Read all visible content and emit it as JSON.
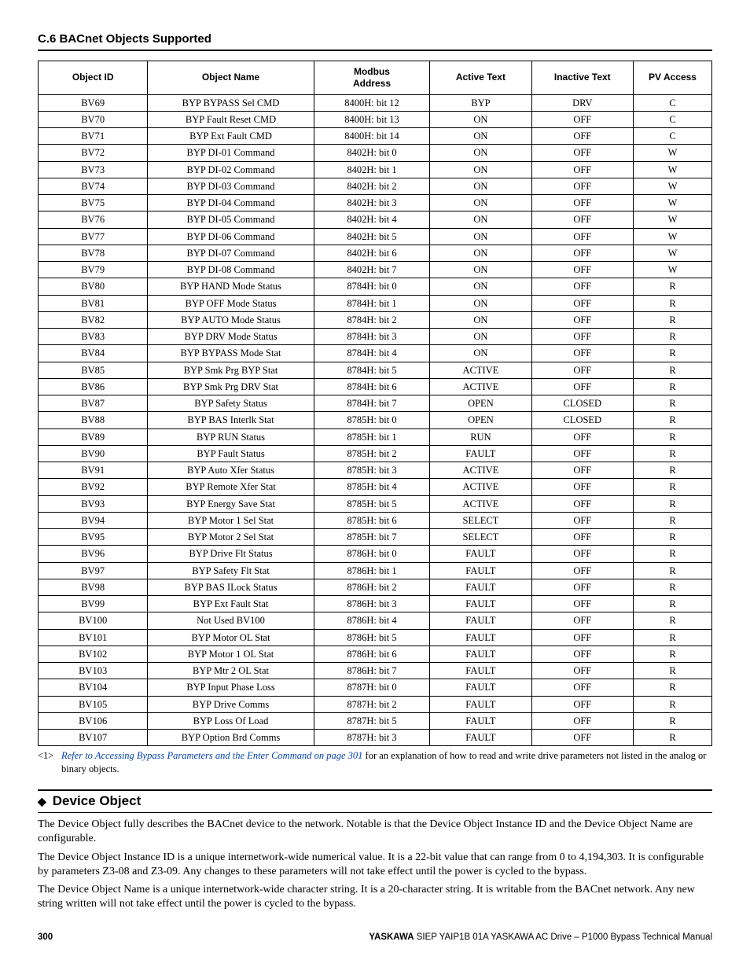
{
  "section_heading": "C.6 BACnet Objects Supported",
  "table": {
    "headers": [
      "Object ID",
      "Object Name",
      "Modbus Address",
      "Active Text",
      "Inactive Text",
      "PV Access"
    ],
    "rows": [
      [
        "BV69",
        "BYP BYPASS Sel CMD",
        "8400H: bit 12",
        "BYP",
        "DRV",
        "C"
      ],
      [
        "BV70",
        "BYP Fault Reset CMD",
        "8400H: bit 13",
        "ON",
        "OFF",
        "C"
      ],
      [
        "BV71",
        "BYP Ext Fault CMD",
        "8400H: bit 14",
        "ON",
        "OFF",
        "C"
      ],
      [
        "BV72",
        "BYP DI-01 Command",
        "8402H: bit 0",
        "ON",
        "OFF",
        "W"
      ],
      [
        "BV73",
        "BYP DI-02 Command",
        "8402H: bit 1",
        "ON",
        "OFF",
        "W"
      ],
      [
        "BV74",
        "BYP DI-03 Command",
        "8402H: bit 2",
        "ON",
        "OFF",
        "W"
      ],
      [
        "BV75",
        "BYP DI-04 Command",
        "8402H: bit 3",
        "ON",
        "OFF",
        "W"
      ],
      [
        "BV76",
        "BYP DI-05 Command",
        "8402H: bit 4",
        "ON",
        "OFF",
        "W"
      ],
      [
        "BV77",
        "BYP DI-06 Command",
        "8402H: bit 5",
        "ON",
        "OFF",
        "W"
      ],
      [
        "BV78",
        "BYP DI-07 Command",
        "8402H: bit 6",
        "ON",
        "OFF",
        "W"
      ],
      [
        "BV79",
        "BYP DI-08 Command",
        "8402H: bit 7",
        "ON",
        "OFF",
        "W"
      ],
      [
        "BV80",
        "BYP HAND Mode Status",
        "8784H: bit 0",
        "ON",
        "OFF",
        "R"
      ],
      [
        "BV81",
        "BYP OFF Mode Status",
        "8784H: bit 1",
        "ON",
        "OFF",
        "R"
      ],
      [
        "BV82",
        "BYP AUTO Mode Status",
        "8784H: bit 2",
        "ON",
        "OFF",
        "R"
      ],
      [
        "BV83",
        "BYP DRV Mode Status",
        "8784H: bit 3",
        "ON",
        "OFF",
        "R"
      ],
      [
        "BV84",
        "BYP BYPASS Mode Stat",
        "8784H: bit 4",
        "ON",
        "OFF",
        "R"
      ],
      [
        "BV85",
        "BYP Smk Prg BYP Stat",
        "8784H: bit 5",
        "ACTIVE",
        "OFF",
        "R"
      ],
      [
        "BV86",
        "BYP Smk Prg DRV Stat",
        "8784H: bit 6",
        "ACTIVE",
        "OFF",
        "R"
      ],
      [
        "BV87",
        "BYP Safety Status",
        "8784H: bit 7",
        "OPEN",
        "CLOSED",
        "R"
      ],
      [
        "BV88",
        "BYP BAS Interlk Stat",
        "8785H: bit 0",
        "OPEN",
        "CLOSED",
        "R"
      ],
      [
        "BV89",
        "BYP RUN Status",
        "8785H: bit 1",
        "RUN",
        "OFF",
        "R"
      ],
      [
        "BV90",
        "BYP Fault Status",
        "8785H: bit 2",
        "FAULT",
        "OFF",
        "R"
      ],
      [
        "BV91",
        "BYP Auto Xfer Status",
        "8785H: bit 3",
        "ACTIVE",
        "OFF",
        "R"
      ],
      [
        "BV92",
        "BYP Remote Xfer Stat",
        "8785H: bit 4",
        "ACTIVE",
        "OFF",
        "R"
      ],
      [
        "BV93",
        "BYP Energy Save Stat",
        "8785H: bit 5",
        "ACTIVE",
        "OFF",
        "R"
      ],
      [
        "BV94",
        "BYP Motor 1 Sel Stat",
        "8785H: bit 6",
        "SELECT",
        "OFF",
        "R"
      ],
      [
        "BV95",
        "BYP Motor 2 Sel Stat",
        "8785H: bit 7",
        "SELECT",
        "OFF",
        "R"
      ],
      [
        "BV96",
        "BYP Drive Flt Status",
        "8786H: bit 0",
        "FAULT",
        "OFF",
        "R"
      ],
      [
        "BV97",
        "BYP Safety Flt Stat",
        "8786H: bit 1",
        "FAULT",
        "OFF",
        "R"
      ],
      [
        "BV98",
        "BYP BAS ILock Status",
        "8786H: bit 2",
        "FAULT",
        "OFF",
        "R"
      ],
      [
        "BV99",
        "BYP Ext Fault Stat",
        "8786H: bit 3",
        "FAULT",
        "OFF",
        "R"
      ],
      [
        "BV100",
        "Not Used BV100",
        "8786H: bit 4",
        "FAULT",
        "OFF",
        "R"
      ],
      [
        "BV101",
        "BYP Motor OL Stat",
        "8786H: bit 5",
        "FAULT",
        "OFF",
        "R"
      ],
      [
        "BV102",
        "BYP Motor 1 OL Stat",
        "8786H: bit 6",
        "FAULT",
        "OFF",
        "R"
      ],
      [
        "BV103",
        "BYP Mtr 2 OL Stat",
        "8786H: bit 7",
        "FAULT",
        "OFF",
        "R"
      ],
      [
        "BV104",
        "BYP Input Phase Loss",
        "8787H: bit 0",
        "FAULT",
        "OFF",
        "R"
      ],
      [
        "BV105",
        "BYP Drive Comms",
        "8787H: bit 2",
        "FAULT",
        "OFF",
        "R"
      ],
      [
        "BV106",
        "BYP Loss Of Load",
        "8787H: bit 5",
        "FAULT",
        "OFF",
        "R"
      ],
      [
        "BV107",
        "BYP Option Brd Comms",
        "8787H: bit 3",
        "FAULT",
        "OFF",
        "R"
      ]
    ]
  },
  "footnote": {
    "mark": "<1>",
    "link": "Refer to Accessing Bypass Parameters and the Enter Command on page 301",
    "rest": " for an explanation of how to read and write drive parameters not listed in the analog or binary objects."
  },
  "device": {
    "heading": "Device Object",
    "p1": "The Device Object fully describes the BACnet device to the network. Notable is that the Device Object Instance ID and the Device Object Name are configurable.",
    "p2": "The Device Object Instance ID is a unique internetwork-wide numerical value. It is a 22-bit value that can range from 0 to 4,194,303. It is configurable by parameters Z3-08 and Z3-09. Any changes to these parameters will not take effect until the power is cycled to the bypass.",
    "p3": "The Device Object Name is a unique internetwork-wide character string. It is a 20-character string. It is writable from the BACnet network. Any new string written will not take effect until the power is cycled to the bypass."
  },
  "footer": {
    "page": "300",
    "brand": "YASKAWA",
    "manual": " SIEP YAIP1B 01A YASKAWA AC Drive – P1000 Bypass Technical Manual"
  }
}
